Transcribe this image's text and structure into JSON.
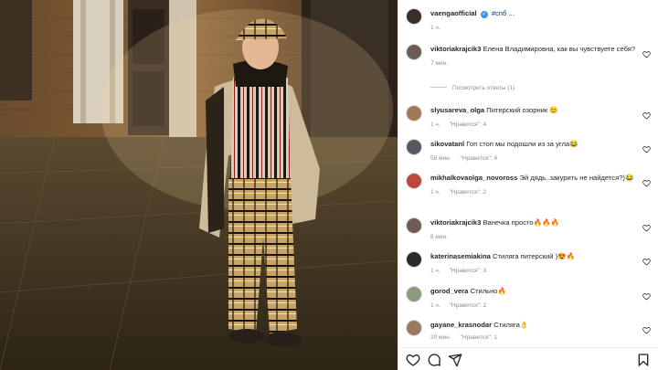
{
  "post": {
    "username": "vaengaofficial",
    "caption": "#спб ...",
    "time": "1 ч."
  },
  "comments": [
    {
      "username": "viktoriakrajcik3",
      "text": "Елена Владимировна, как вы чувствуете себя?",
      "time": "7 мин.",
      "likes": ""
    },
    {
      "username": "slyusareva_olga",
      "text": "Питерский озорник 😊",
      "time": "1 ч.",
      "likes": "\"Нравится\": 4"
    },
    {
      "username": "sikovatanl",
      "text": "Гоп стоп мы подошли из за угла😂",
      "time": "58 мин.",
      "likes": "\"Нравится\": 4"
    },
    {
      "username": "mikhalkovaolga_novoross",
      "text": "Эй дядь..закурить не найдется?)😂",
      "time": "1 ч.",
      "likes": "\"Нравится\": 2"
    },
    {
      "username": "viktoriakrajcik3",
      "text": "Ванечка просто🔥🔥🔥",
      "time": "8 мин.",
      "likes": ""
    },
    {
      "username": "katerinasemiakina",
      "text": "Стиляга питерский )😍🔥",
      "time": "1 ч.",
      "likes": "\"Нравится\": 3"
    },
    {
      "username": "gorod_vera",
      "text": "Стильно🔥",
      "time": "1 ч.",
      "likes": "\"Нравится\": 2"
    },
    {
      "username": "gayane_krasnodar",
      "text": "Стиляга👌",
      "time": "20 мин.",
      "likes": "\"Нравится\": 1"
    }
  ],
  "view_replies": "Посмотреть ответы (1)",
  "colors": {
    "accent": "#3897f0",
    "muted": "#8e8e8e",
    "link": "#00376b"
  },
  "icons": {
    "like": "heart-icon",
    "comment": "comment-icon",
    "share": "share-icon",
    "save": "bookmark-icon"
  }
}
